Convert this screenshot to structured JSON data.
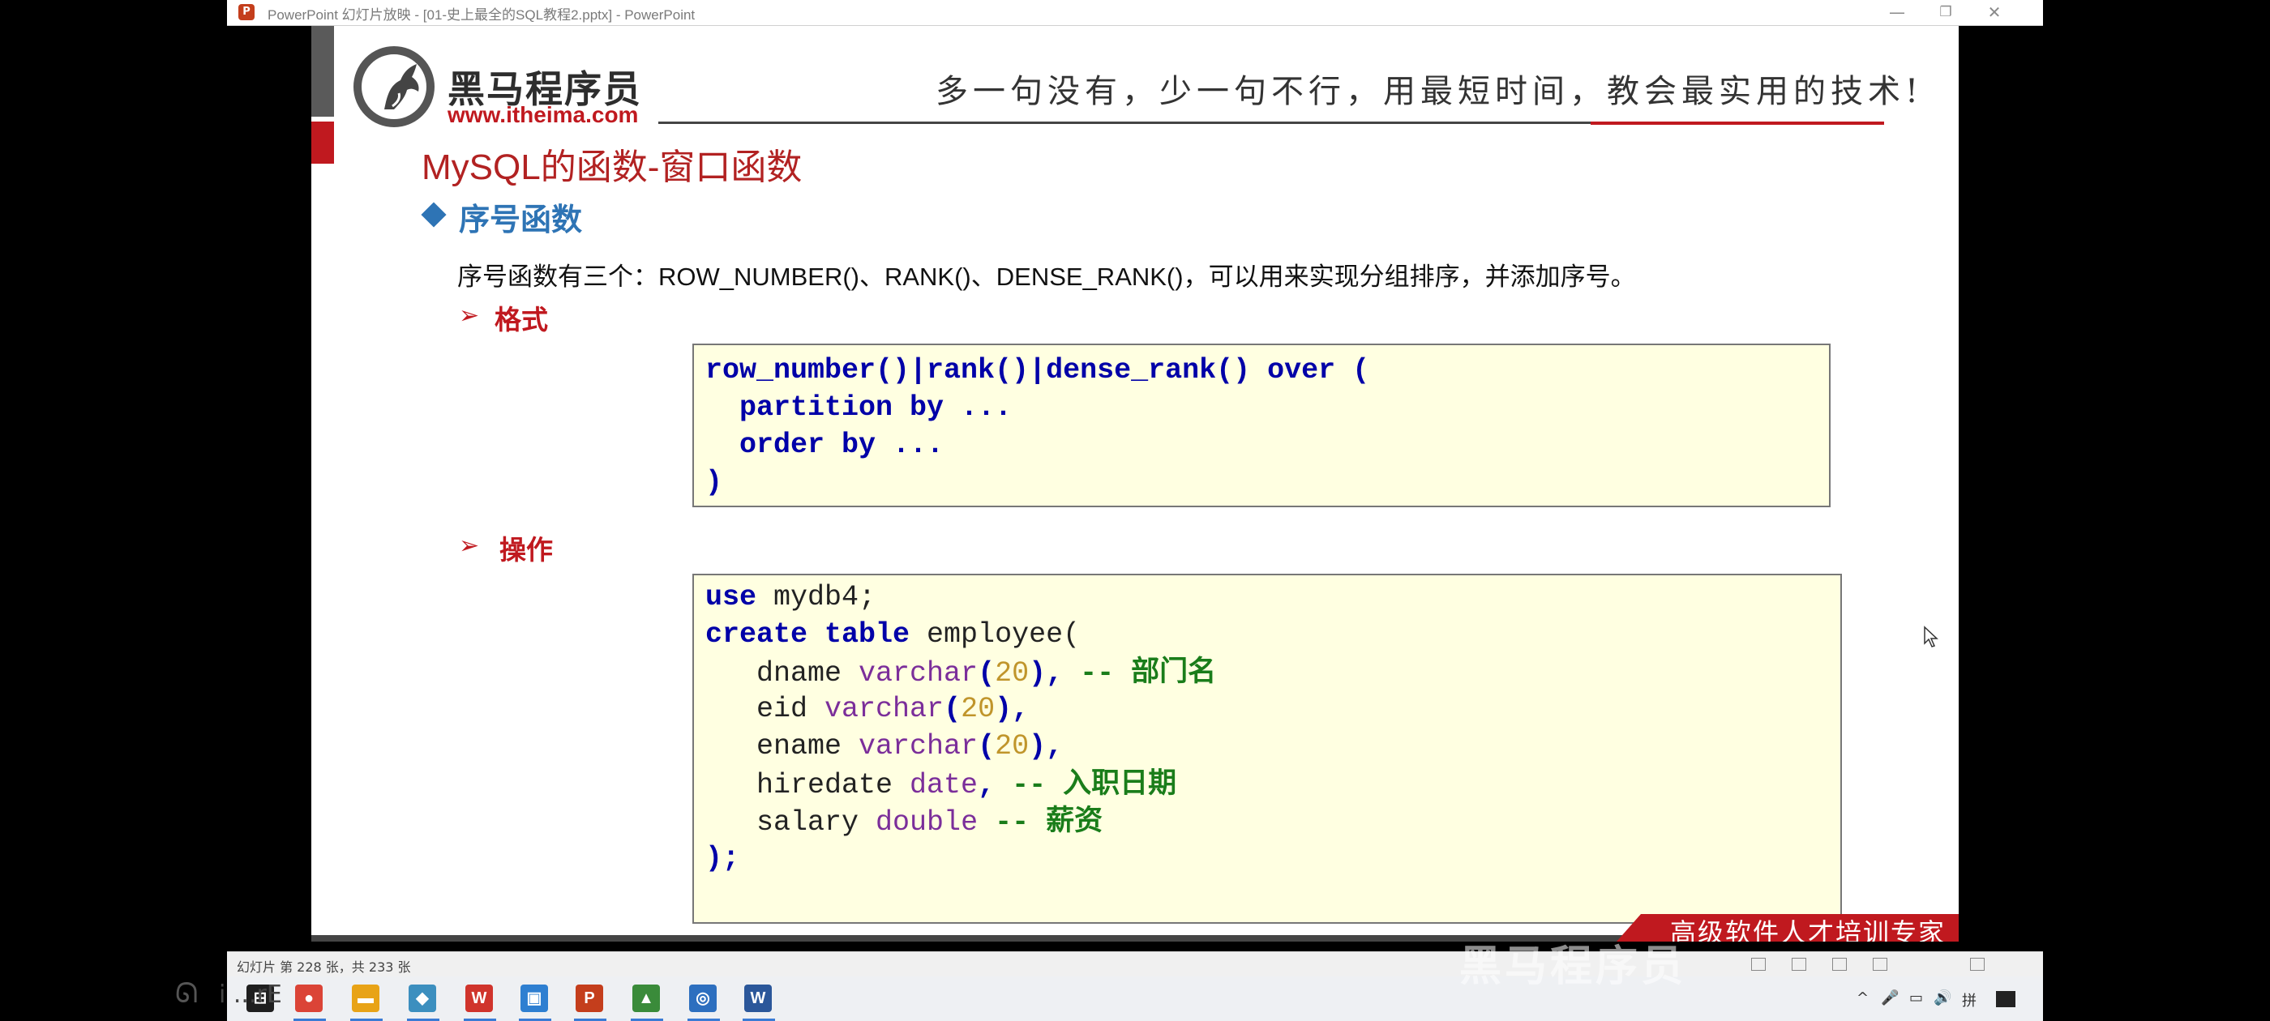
{
  "window": {
    "title": "PowerPoint 幻灯片放映 - [01-史上最全的SQL教程2.pptx] - PowerPoint",
    "app_icon": "P",
    "controls": [
      "—",
      "❐",
      "✕"
    ]
  },
  "slide": {
    "logo": {
      "name": "黑马程序员",
      "url": "www.itheima.com"
    },
    "slogan": "多一句没有，少一句不行，用最短时间，教会最实用的技术!",
    "title": "MySQL的函数-窗口函数",
    "section_heading": "序号函数",
    "intro": "序号函数有三个：ROW_NUMBER()、RANK()、DENSE_RANK()，可以用来实现分组排序，并添加序号。",
    "format_heading": "格式",
    "operation_heading": "操作",
    "arrow": "➢",
    "syntax": {
      "line1": "row_number()|rank()|dense_rank() over (",
      "line2": "  partition by ...",
      "line3": "  order by ...",
      "line4": ")"
    },
    "code": {
      "l1_kw": "use",
      "l1_rest": " mydb4;",
      "l2_kw": "create table",
      "l2_rest": " employee(",
      "l3_name": "   dname ",
      "l3_type": "varchar",
      "l3_num": "20",
      "l3_comment_dash": "-- ",
      "l3_comment": "部门名",
      "l4_name": "   eid ",
      "l4_type": "varchar",
      "l4_num": "20",
      "l5_name": "   ename ",
      "l5_type": "varchar",
      "l5_num": "20",
      "l6_name": "   hiredate ",
      "l6_type": "date",
      "l6_comment_dash": "-- ",
      "l6_comment": "入职日期",
      "l7_name": "   salary ",
      "l7_type": "double",
      "l7_comment_dash": " -- ",
      "l7_comment": "薪资",
      "l8": ");"
    },
    "footer": "高级软件人才培训专家"
  },
  "statusbar": {
    "slide_counter": "幻灯片 第 228 张，共 233 张"
  },
  "taskbar": {
    "apps": [
      {
        "icon": "windows-start-icon",
        "label": "⊞",
        "color": "#1f1f1f"
      },
      {
        "icon": "chrome-icon",
        "label": "●",
        "color": "#db4437"
      },
      {
        "icon": "file-explorer-icon",
        "label": "▬",
        "color": "#e8a317"
      },
      {
        "icon": "app-icon",
        "label": "◆",
        "color": "#3c8fbf"
      },
      {
        "icon": "wps-icon",
        "label": "W",
        "color": "#d0342c"
      },
      {
        "icon": "app2-icon",
        "label": "▣",
        "color": "#2e7fd1"
      },
      {
        "icon": "powerpoint-icon",
        "label": "P",
        "color": "#c43e1c"
      },
      {
        "icon": "app3-icon",
        "label": "▲",
        "color": "#3a8b3a"
      },
      {
        "icon": "app4-icon",
        "label": "◎",
        "color": "#2d6fbf"
      },
      {
        "icon": "word-icon",
        "label": "W",
        "color": "#2b579a"
      }
    ],
    "tray": [
      "^",
      "🎤",
      "▭",
      "🔊",
      "拼"
    ]
  },
  "overlay": {
    "watermark": "黑马程序员",
    "outside_text": "i ...rE"
  }
}
